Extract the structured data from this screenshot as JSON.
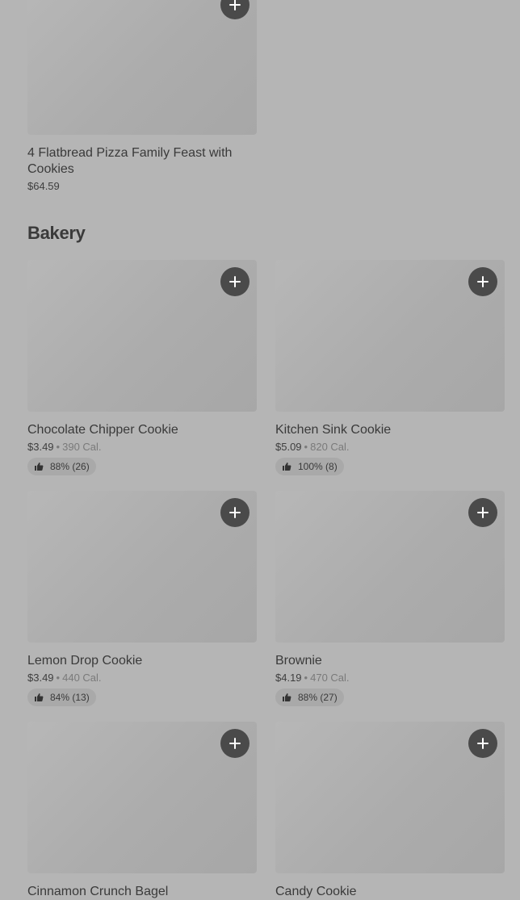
{
  "top_item": {
    "name": "4 Flatbread Pizza Family Feast with Cookies",
    "price": "$64.59"
  },
  "section": {
    "title": "Bakery"
  },
  "items": [
    {
      "name": "Chocolate Chipper Cookie",
      "price": "$3.49",
      "separator": "•",
      "calories": "390 Cal.",
      "rating": "88% (26)"
    },
    {
      "name": "Kitchen Sink Cookie",
      "price": "$5.09",
      "separator": "•",
      "calories": "820 Cal.",
      "rating": "100% (8)"
    },
    {
      "name": "Lemon Drop Cookie",
      "price": "$3.49",
      "separator": "•",
      "calories": "440 Cal.",
      "rating": "84% (13)"
    },
    {
      "name": "Brownie",
      "price": "$4.19",
      "separator": "•",
      "calories": "470 Cal.",
      "rating": "88% (27)"
    },
    {
      "name": "Cinnamon Crunch Bagel"
    },
    {
      "name": "Candy Cookie"
    }
  ],
  "icons": {
    "add": "plus-icon",
    "rating": "thumbs-up-icon"
  },
  "colors": {
    "background": "#b5b5b5",
    "button": "#4a4a4a",
    "rating_pill": "#a9a9a9"
  }
}
